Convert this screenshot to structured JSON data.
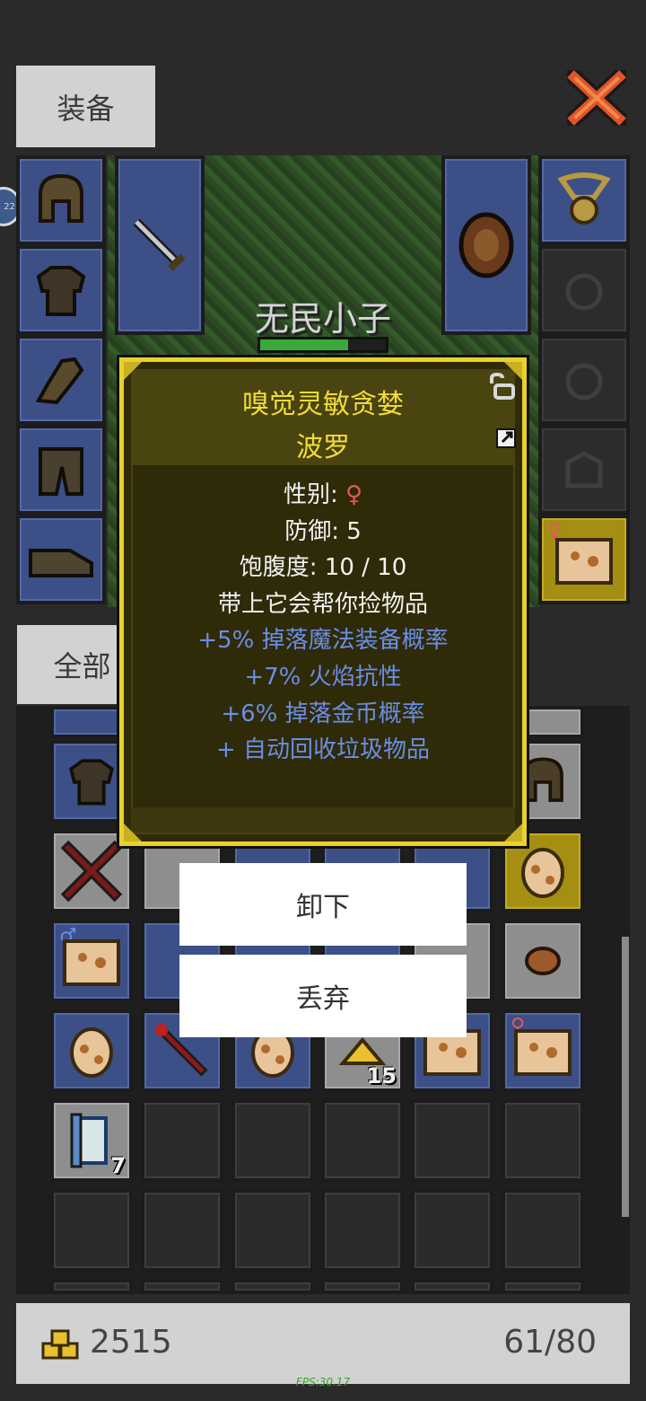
{
  "tabs": {
    "equipment": "装备",
    "all": "全部"
  },
  "hero": {
    "name": "无民小子",
    "health_fraction": 0.7
  },
  "popup": {
    "title_line1": "嗅觉灵敏贪婪",
    "title_line2": "波罗",
    "stats": [
      {
        "label": "性别: ",
        "value": "♀",
        "color": "#e05a5a"
      },
      {
        "label": "防御: 5"
      },
      {
        "label": "饱腹度: 10 / 10"
      },
      {
        "label": "带上它会帮你捡物品"
      },
      {
        "label": "+5% 掉落魔法装备概率",
        "color": "#6a8ee6"
      },
      {
        "label": "+7% 火焰抗性",
        "color": "#6a8ee6"
      },
      {
        "label": "+6% 掉落金币概率",
        "color": "#6a8ee6"
      },
      {
        "label": "+ 自动回收垃圾物品",
        "color": "#6a8ee6"
      }
    ]
  },
  "menu": {
    "unequip": "卸下",
    "discard": "丢弃"
  },
  "inventory": {
    "stack_counts": {
      "gold_pile": "15",
      "scroll": "7"
    }
  },
  "footer": {
    "gold": "2515",
    "capacity": "61/80",
    "fps": "FPS:30.17"
  },
  "side_badge": "22",
  "colors": {
    "popup_bg": "#2f2a08",
    "popup_border": "#e8d22a",
    "title": "#f2dc3a",
    "buff": "#6a8ee6",
    "female": "#e05a5a"
  }
}
